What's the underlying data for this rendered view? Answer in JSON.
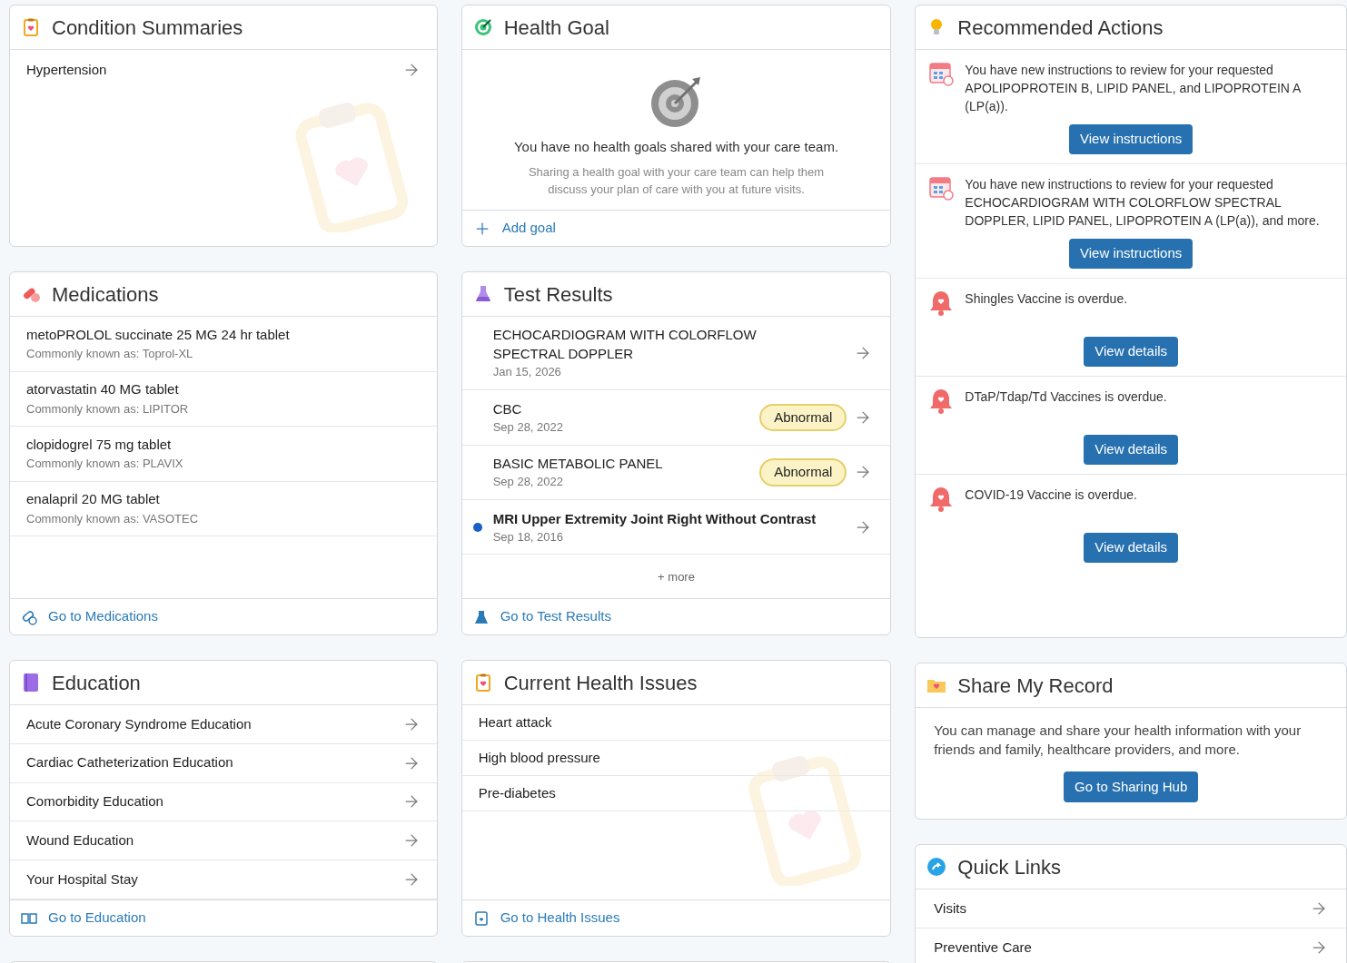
{
  "condition_summaries": {
    "title": "Condition Summaries",
    "items": [
      "Hypertension"
    ]
  },
  "health_goal": {
    "title": "Health Goal",
    "message": "You have no health goals shared with your care team.",
    "hint": "Sharing a health goal with your care team can help them discuss your plan of care with you at future visits.",
    "action": "Add goal"
  },
  "recommended_actions": {
    "title": "Recommended Actions",
    "items": [
      {
        "kind": "instructions",
        "text": "You have new instructions to review for your requested APOLIPOPROTEIN B, LIPID PANEL, and LIPOPROTEIN A (LP(a)).",
        "button": "View instructions"
      },
      {
        "kind": "instructions",
        "text": "You have new instructions to review for your requested ECHOCARDIOGRAM WITH COLORFLOW SPECTRAL DOPPLER, LIPID PANEL, LIPOPROTEIN A (LP(a)), and more.",
        "button": "View instructions"
      },
      {
        "kind": "overdue",
        "text": "Shingles Vaccine is overdue.",
        "button": "View details"
      },
      {
        "kind": "overdue",
        "text": "DTaP/Tdap/Td Vaccines is overdue.",
        "button": "View details"
      },
      {
        "kind": "overdue",
        "text": "COVID-19 Vaccine is overdue.",
        "button": "View details"
      }
    ]
  },
  "medications": {
    "title": "Medications",
    "items": [
      {
        "name": "metoPROLOL succinate 25 MG 24 hr tablet",
        "alias": "Commonly known as: Toprol-XL"
      },
      {
        "name": "atorvastatin 40 MG tablet",
        "alias": "Commonly known as: LIPITOR"
      },
      {
        "name": "clopidogrel 75 mg tablet",
        "alias": "Commonly known as: PLAVIX"
      },
      {
        "name": "enalapril 20 MG tablet",
        "alias": "Commonly known as: VASOTEC"
      }
    ],
    "footer": "Go to Medications"
  },
  "test_results": {
    "title": "Test Results",
    "items": [
      {
        "name": "ECHOCARDIOGRAM WITH COLORFLOW SPECTRAL DOPPLER",
        "date": "Jan 15, 2026",
        "unread": false
      },
      {
        "name": "CBC",
        "date": "Sep 28, 2022",
        "badge": "Abnormal",
        "unread": false
      },
      {
        "name": "BASIC METABOLIC PANEL",
        "date": "Sep 28, 2022",
        "badge": "Abnormal",
        "unread": false
      },
      {
        "name": "MRI Upper Extremity Joint Right Without Contrast",
        "date": "Sep 18, 2016",
        "unread": true
      }
    ],
    "more": "+ more",
    "footer": "Go to Test Results"
  },
  "share_my_record": {
    "title": "Share My Record",
    "text": "You can manage and share your health information with your friends and family, healthcare providers, and more.",
    "button": "Go to Sharing Hub"
  },
  "education": {
    "title": "Education",
    "items": [
      "Acute Coronary Syndrome Education",
      "Cardiac Catheterization Education",
      "Comorbidity Education",
      "Wound Education",
      "Your Hospital Stay"
    ],
    "footer": "Go to Education"
  },
  "current_health_issues": {
    "title": "Current Health Issues",
    "items": [
      "Heart attack",
      "High blood pressure",
      "Pre-diabetes"
    ],
    "footer": "Go to Health Issues"
  },
  "quick_links": {
    "title": "Quick Links",
    "items": [
      "Visits",
      "Preventive Care"
    ]
  }
}
